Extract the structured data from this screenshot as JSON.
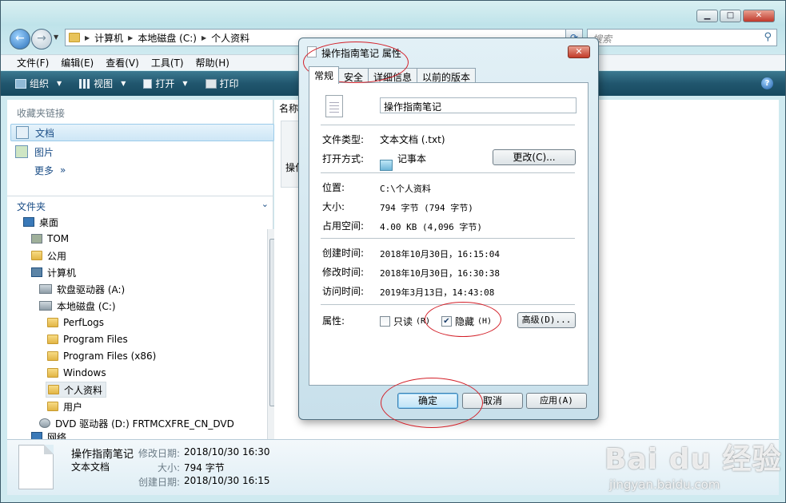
{
  "explorer": {
    "address": [
      "计算机",
      "本地磁盘 (C:)",
      "个人资料"
    ],
    "search_placeholder": "搜索",
    "menu": [
      "文件(F)",
      "编辑(E)",
      "查看(V)",
      "工具(T)",
      "帮助(H)"
    ],
    "toolbar": [
      "组织",
      "视图",
      "打开",
      "打印"
    ],
    "favorites_title": "收藏夹链接",
    "favorites": [
      "文档",
      "图片",
      "更多"
    ],
    "folders_title": "文件夹",
    "tree": [
      "桌面",
      "TOM",
      "公用",
      "计算机",
      "软盘驱动器 (A:)",
      "本地磁盘 (C:)",
      "PerfLogs",
      "Program Files",
      "Program Files (x86)",
      "Windows",
      "个人资料",
      "用户",
      "DVD 驱动器 (D:) FRTMCXFRE_CN_DVD",
      "网络"
    ],
    "column_header": "名称",
    "file_snippet": "操作"
  },
  "details": {
    "name": "操作指南笔记",
    "type": "文本文档",
    "modified_label": "修改日期:",
    "modified": "2018/10/30 16:30",
    "size_label": "大小:",
    "size": "794 字节",
    "created_label": "创建日期:",
    "created": "2018/10/30 16:15"
  },
  "watermark": {
    "logo": "Bai du 经验",
    "url": "jingyan.baidu.com"
  },
  "dialog": {
    "title": "操作指南笔记 属性",
    "tabs": [
      "常规",
      "安全",
      "详细信息",
      "以前的版本"
    ],
    "filename": "操作指南笔记",
    "rows": {
      "type_label": "文件类型:",
      "type": "文本文档 (.txt)",
      "open_label": "打开方式:",
      "open": "记事本",
      "change": "更改(C)...",
      "location_label": "位置:",
      "location": "C:\\个人资料",
      "size_label": "大小:",
      "size": "794 字节 (794 字节)",
      "disk_label": "占用空间:",
      "disk": "4.00 KB (4,096 字节)",
      "created_label": "创建时间:",
      "created": "2018年10月30日，16:15:04",
      "modified_label": "修改时间:",
      "modified": "2018年10月30日，16:30:38",
      "accessed_label": "访问时间:",
      "accessed": "2019年3月13日，14:43:08",
      "attrs_label": "属性:",
      "readonly": "只读",
      "readonly_key": "(R)",
      "hidden": "隐藏",
      "hidden_key": "(H)",
      "advanced": "高级(D)..."
    },
    "buttons": {
      "ok": "确定",
      "cancel": "取消",
      "apply": "应用(A)"
    },
    "hidden_checked": true,
    "readonly_checked": false
  },
  "colors": {
    "highlight_ring": "#d32029",
    "toolbar": "#21566e"
  }
}
